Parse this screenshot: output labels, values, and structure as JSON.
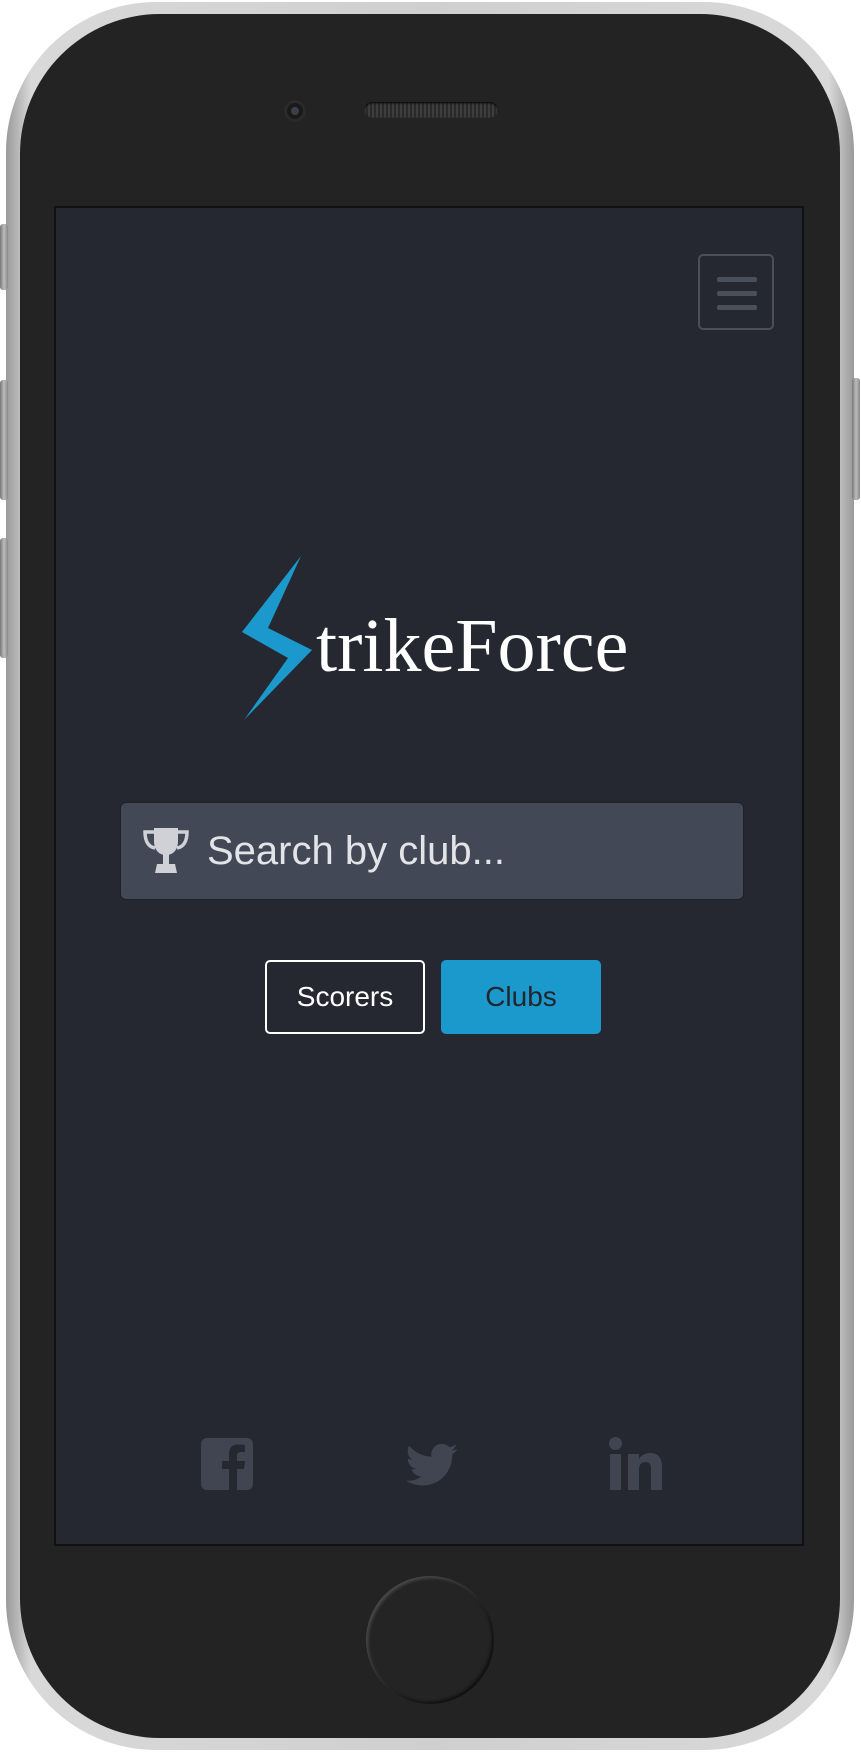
{
  "app": {
    "logo_text": "trikeForce",
    "logo_mark": "lightning-bolt-icon",
    "brand_color": "#1b99cc",
    "background_color": "#252830"
  },
  "header": {
    "menu_icon": "hamburger-menu-icon"
  },
  "search": {
    "placeholder": "Search by club...",
    "value": "",
    "icon": "trophy-icon"
  },
  "mode_toggle": {
    "options": [
      {
        "label": "Scorers",
        "selected": false
      },
      {
        "label": "Clubs",
        "selected": true
      }
    ]
  },
  "footer": {
    "social_icons": [
      "facebook-icon",
      "twitter-icon",
      "linkedin-icon"
    ]
  }
}
